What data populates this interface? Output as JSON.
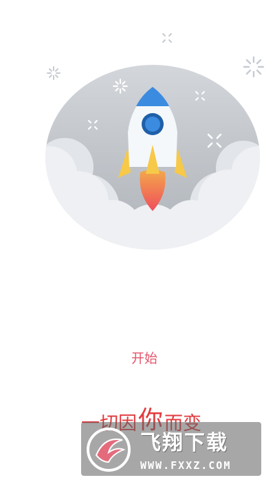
{
  "hero": {
    "icons": [
      "rocket-icon",
      "cloud-icon",
      "sparkle-icon"
    ],
    "colors": {
      "circle": "#c9ccd1",
      "cloud": "#eef0f3",
      "rocket_body": "#f4f8fb",
      "rocket_nose": "#3b8be0",
      "fins": "#f7c948",
      "flame_top": "#f3a94a",
      "flame_bottom": "#ef4e5c"
    }
  },
  "start_button": {
    "label": "开始",
    "color": "#e2566e"
  },
  "slogan": {
    "part1": "一切因",
    "highlight": "你",
    "part2": "而变",
    "color": "#e23a3e"
  },
  "watermark": {
    "title": "飞翔下载",
    "url": "WWW.FXXZ.COM"
  }
}
